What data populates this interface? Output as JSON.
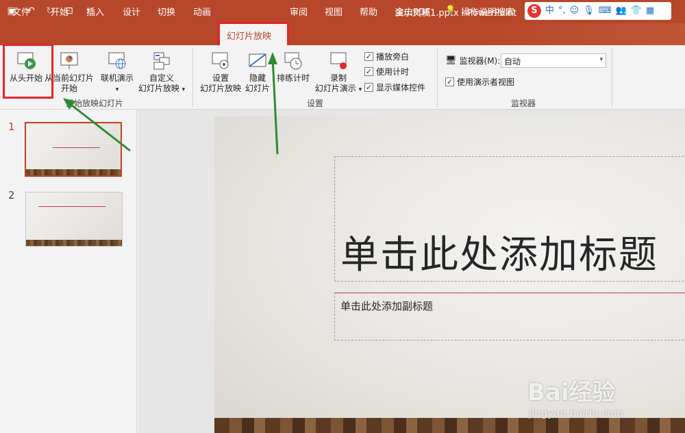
{
  "title_bar": {
    "document_title": "演示文稿1.pptx  -  PowerPoint",
    "qat_icons": [
      "save-icon",
      "undo-icon",
      "redo-icon",
      "present-icon",
      "customize-icon"
    ],
    "ime": {
      "logo": "S",
      "mode": "中",
      "punct": "°,",
      "icons": [
        "emoji-icon",
        "microphone-icon",
        "keyboard-icon",
        "users-icon",
        "shirt-icon",
        "grid-icon"
      ]
    }
  },
  "tabs": [
    "文件",
    "开始",
    "插入",
    "设计",
    "切换",
    "动画",
    "幻灯片放映",
    "审阅",
    "视图",
    "帮助",
    "金山PDF",
    "操作说明搜索"
  ],
  "ribbon": {
    "start_group": {
      "label": "开始放映幻灯片",
      "from_beginning": "从头开始",
      "from_current_l1": "从当前幻灯片",
      "from_current_l2": "开始",
      "online_l1": "联机演示",
      "custom_l1": "自定义",
      "custom_l2": "幻灯片放映"
    },
    "setup_group": {
      "label": "设置",
      "setup_l1": "设置",
      "setup_l2": "幻灯片放映",
      "hide_l1": "隐藏",
      "hide_l2": "幻灯片",
      "rehearse": "排练计时",
      "record_l1": "录制",
      "record_l2": "幻灯片演示",
      "checks": [
        "播放旁白",
        "使用计时",
        "显示媒体控件"
      ]
    },
    "monitor_group": {
      "label": "监视器",
      "monitor_label": "监视器(M):",
      "monitor_value": "自动",
      "presenter_view": "使用演示者视图"
    }
  },
  "slides": [
    {
      "number": "1",
      "selected": true
    },
    {
      "number": "2",
      "selected": false
    }
  ],
  "slide": {
    "title_placeholder": "单击此处添加标题",
    "subtitle_placeholder": "单击此处添加副标题"
  },
  "watermark": {
    "main": "Bai经验",
    "sub": "jingyan.baidu.com"
  },
  "colors": {
    "accent": "#b7472a",
    "highlight": "#e8232a",
    "arrow": "#2e8b32"
  }
}
